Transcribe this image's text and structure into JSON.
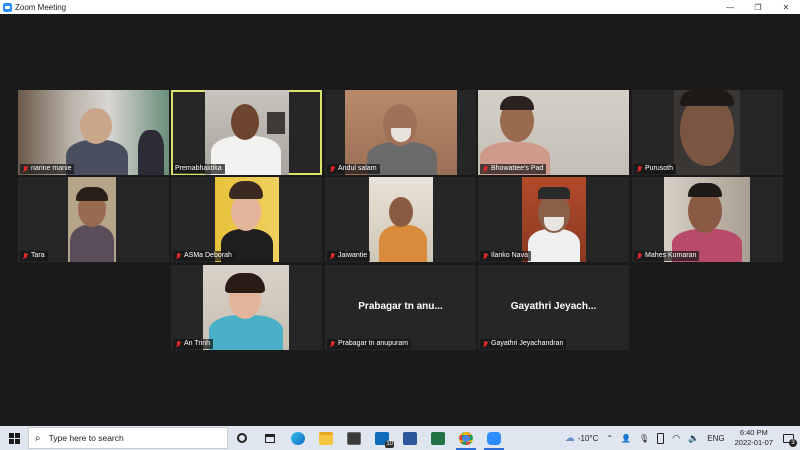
{
  "window": {
    "title": "Zoom Meeting",
    "controls": [
      "—",
      "❐",
      "✕"
    ]
  },
  "participants": [
    {
      "name": "narine manie",
      "video": true,
      "active": false
    },
    {
      "name": "Premabhaktika",
      "video": true,
      "active": true
    },
    {
      "name": "Andul salam",
      "video": true,
      "active": false
    },
    {
      "name": "Bhowattee's Pad",
      "video": true,
      "active": false
    },
    {
      "name": "Purusoth",
      "video": true,
      "active": false
    },
    {
      "name": "Tara",
      "video": true,
      "active": false
    },
    {
      "name": "ASMa Deborah",
      "video": true,
      "active": false
    },
    {
      "name": "Jaiwantie",
      "video": true,
      "active": false
    },
    {
      "name": "Ilanko Nava",
      "video": true,
      "active": false
    },
    {
      "name": "Mahes Kumaran",
      "video": true,
      "active": false
    },
    {
      "name": "An Trinh",
      "video": true,
      "active": false
    },
    {
      "name": "Prabagar tn anupuram",
      "display": "Prabagar tn anu...",
      "video": false,
      "active": false
    },
    {
      "name": "Gayathri Jeyachandran",
      "display": "Gayathri Jeyach...",
      "video": false,
      "active": false
    }
  ],
  "taskbar": {
    "search_placeholder": "Type here to search",
    "apps": [
      "task-view",
      "widgets",
      "edge",
      "file-explorer",
      "store",
      "mail",
      "word",
      "excel",
      "chrome",
      "zoom"
    ],
    "mail_badge": "10",
    "weather": "-10°C",
    "language": "ENG",
    "time": "6:40 PM",
    "date": "2022-01-07",
    "notification_count": "3"
  },
  "colors": {
    "active_speaker_border": "#d9e36a",
    "muted_icon": "#e02828",
    "zoom_blue": "#2d8cff"
  }
}
